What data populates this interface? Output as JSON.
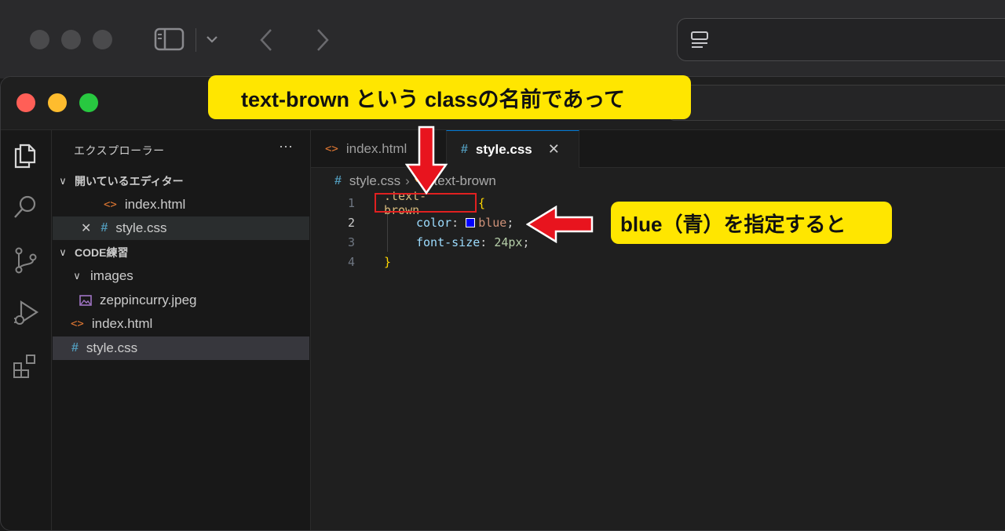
{
  "explorer": {
    "title": "エクスプローラー",
    "more": "···",
    "open_editors_label": "開いているエディター",
    "open_editors": [
      {
        "name": "index.html",
        "icon": "html-icon"
      },
      {
        "name": "style.css",
        "icon": "css-icon",
        "close": "✕"
      }
    ],
    "folder_label": "CODE練習",
    "tree": {
      "images_folder": "images",
      "image_file": "zeppincurry.jpeg",
      "html_file": "index.html",
      "css_file": "style.css"
    }
  },
  "tabs": [
    {
      "label": "index.html",
      "icon": "html-icon",
      "active": false
    },
    {
      "label": "style.css",
      "icon": "css-icon",
      "active": true,
      "close": "✕"
    }
  ],
  "breadcrumb": {
    "file": "style.css",
    "symbol": ".text-brown"
  },
  "code": {
    "line_numbers": [
      "1",
      "2",
      "3",
      "4"
    ],
    "selector": ".text-brown",
    "open_brace": "{",
    "prop1": "color",
    "val1": "blue",
    "prop2": "font-size",
    "val2": "24px",
    "close_brace": "}",
    "colon": ":",
    "semi": ";"
  },
  "annotations": {
    "callout_top": "text-brown  という classの名前であって",
    "callout_right": "blue（青）を指定すると",
    "color": "#ffe600",
    "arrow_color": "#e8141e"
  }
}
